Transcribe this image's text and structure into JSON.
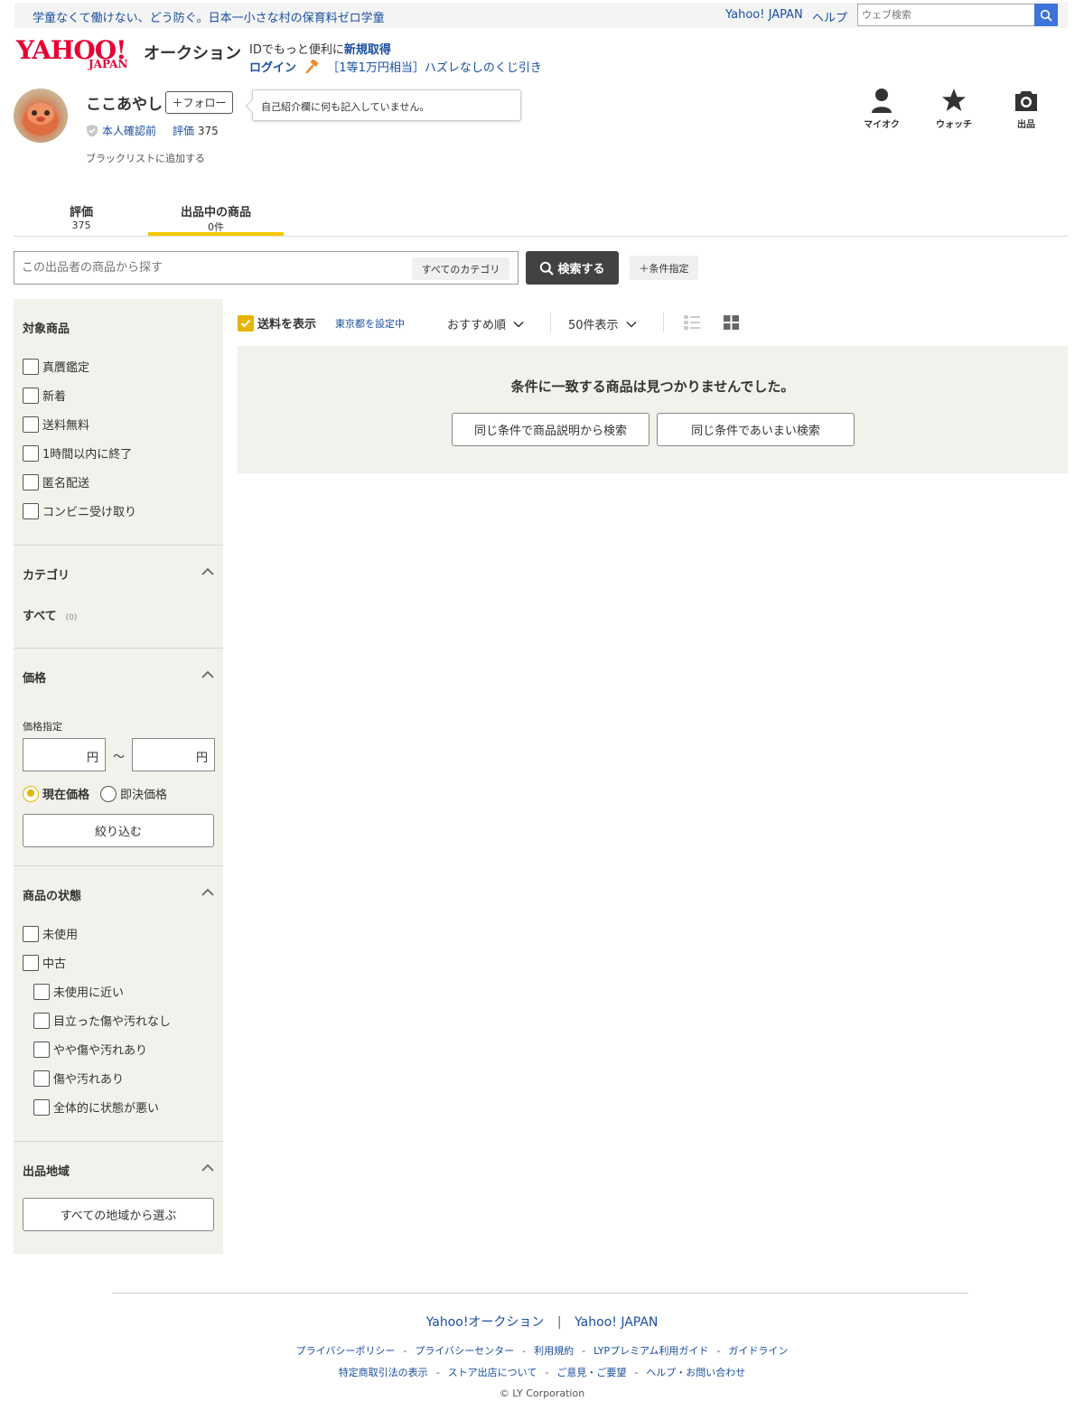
{
  "topbar": {
    "promo": "学童なくて働けない、どう防ぐ。日本一小さな村の保育料ゼロ学童",
    "yahoo_japan": "Yahoo! JAPAN",
    "help": "ヘルプ",
    "web_search_placeholder": "ウェブ検索"
  },
  "header": {
    "logo_yahoo": "YAHOO!",
    "logo_japan": "JAPAN",
    "logo_auction": "オークション",
    "id_prefix": "IDでもっと便利に",
    "id_new": "新規取得",
    "login": "ログイン",
    "lottery": "［1等1万円相当］ハズレなしのくじ引き"
  },
  "profile": {
    "name": "ここあやし",
    "follow": "＋フォロー",
    "bio": "自己紹介欄に何も記入していません。",
    "verify": "本人確認前",
    "rating_label": "評価",
    "rating_value": "375",
    "blacklist": "ブラックリストに追加する"
  },
  "header_icons": {
    "myauction": "マイオク",
    "watch": "ウォッチ",
    "sell": "出品"
  },
  "tabs": [
    {
      "title": "評価",
      "sub": "375"
    },
    {
      "title": "出品中の商品",
      "sub": "0件"
    }
  ],
  "search": {
    "placeholder": "この出品者の商品から探す",
    "category": "すべてのカテゴリ",
    "button": "検索する",
    "conditions": "＋条件指定"
  },
  "sidebar": {
    "target_title": "対象商品",
    "target_items": [
      "真贋鑑定",
      "新着",
      "送料無料",
      "1時間以内に終了",
      "匿名配送",
      "コンビニ受け取り"
    ],
    "category_title": "カテゴリ",
    "category_all": "すべて",
    "category_count": "(0)",
    "price_title": "価格",
    "price_label": "価格指定",
    "yen": "円",
    "tilde": "～",
    "price_current": "現在価格",
    "price_buynow": "即決価格",
    "narrow": "絞り込む",
    "condition_title": "商品の状態",
    "condition_items": [
      "未使用",
      "中古"
    ],
    "condition_sub_items": [
      "未使用に近い",
      "目立った傷や汚れなし",
      "やや傷や汚れあり",
      "傷や汚れあり",
      "全体的に状態が悪い"
    ],
    "region_title": "出品地域",
    "region_button": "すべての地域から選ぶ"
  },
  "results": {
    "shipping": "送料を表示",
    "tokyo": "東京都を設定中",
    "sort": "おすすめ順",
    "per_page": "50件表示",
    "empty": "条件に一致する商品は見つかりませんでした。",
    "btn_desc": "同じ条件で商品説明から検索",
    "btn_fuzzy": "同じ条件であいまい検索"
  },
  "footer": {
    "auction": "Yahoo!オークション",
    "bar": "|",
    "yahoo_japan": "Yahoo! JAPAN",
    "links1": [
      "プライバシーポリシー",
      "プライバシーセンター",
      "利用規約",
      "LYPプレミアム利用ガイド",
      "ガイドライン"
    ],
    "links2": [
      "特定商取引法の表示",
      "ストア出店について",
      "ご意見・ご要望",
      "ヘルプ・お問い合わせ"
    ],
    "sep": "-",
    "copyright": "© LY Corporation"
  },
  "colors": {
    "accent_yellow": "#f5c800",
    "link_blue": "#1a4fa0",
    "brand_red": "#e60033",
    "sidebar_bg": "#f2f1ec"
  }
}
